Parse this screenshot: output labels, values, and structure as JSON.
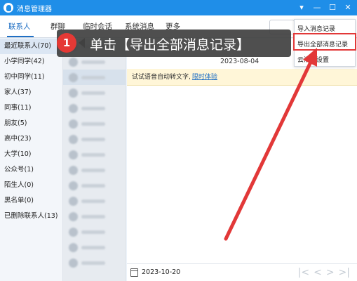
{
  "window": {
    "title": "消息管理器"
  },
  "window_buttons": [
    "▾",
    "—",
    "☐",
    "✕"
  ],
  "tabs": [
    {
      "label": "联系人",
      "active": true
    },
    {
      "label": "群聊"
    },
    {
      "label": "临时会话"
    },
    {
      "label": "系统消息"
    },
    {
      "label": "更多"
    }
  ],
  "sidebar": {
    "items": [
      {
        "label": "最近联系人(70)",
        "selected": true
      },
      {
        "label": "小学同学(42)"
      },
      {
        "label": "初中同学(11)"
      },
      {
        "label": "家人(37)"
      },
      {
        "label": "同事(11)"
      },
      {
        "label": "朋友(5)"
      },
      {
        "label": "高中(23)"
      },
      {
        "label": "大学(10)"
      },
      {
        "label": "公众号(1)"
      },
      {
        "label": "陌生人(0)"
      },
      {
        "label": "黑名单(0)"
      },
      {
        "label": "已删除联系人(13)"
      }
    ]
  },
  "main": {
    "top_date": "2023-08-04",
    "notice_text": "试试语音自动转文字,",
    "notice_link": "限时体验",
    "bottom_date": "2023-10-20",
    "pager_icons": [
      "first-page-icon",
      "prev-page-icon",
      "next-page-icon",
      "last-page-icon"
    ]
  },
  "dropdown": {
    "items": [
      "导入消息记录",
      "导出全部消息记录",
      "云消息设置"
    ]
  },
  "callout": {
    "step": "1",
    "text": "单击【导出全部消息记录】"
  },
  "colors": {
    "titlebar": "#1f8ee8",
    "accent": "#1f6fc4",
    "highlight": "#e23838",
    "callout_bg": "#404040",
    "badge": "#e53935"
  }
}
